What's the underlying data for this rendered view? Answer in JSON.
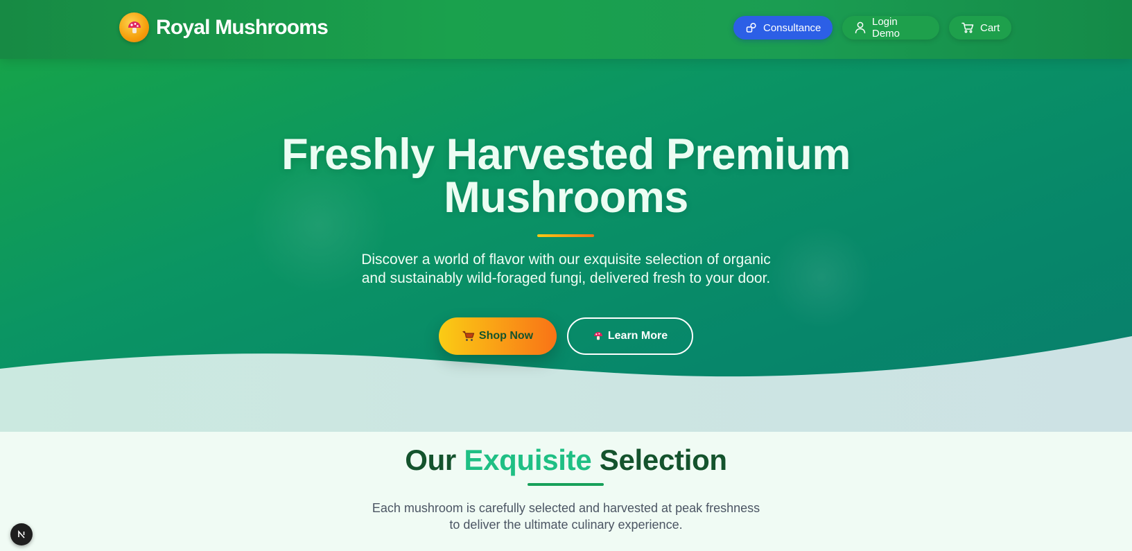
{
  "header": {
    "brand": "Royal Mushrooms",
    "nav": {
      "consult_label": "Consultance",
      "login_label": "Login Demo",
      "cart_label": "Cart"
    }
  },
  "hero": {
    "title_line1": "Freshly Harvested Premium",
    "title_line2": "Mushrooms",
    "subtitle_line1": "Discover a world of flavor with our exquisite selection of organic",
    "subtitle_line2": "and sustainably wild-foraged fungi, delivered fresh to your door.",
    "shop_label": "Shop Now",
    "learn_label": "Learn More"
  },
  "section": {
    "title_part1": "Our",
    "title_accent": "Exquisite",
    "title_part2": "Selection",
    "subtitle_line1": "Each mushroom is carefully selected and harvested at peak freshness",
    "subtitle_line2": "to deliver the ultimate culinary experience."
  },
  "colors": {
    "primary_green": "#1aa14d",
    "consult_blue": "#2c5fe6",
    "accent_yellow": "#facc15",
    "accent_orange": "#f97316",
    "title_dark_green": "#14532d",
    "title_accent": "#1fbf84"
  },
  "icons": {
    "logo": "mushroom-icon",
    "consult": "shapes-icon",
    "login": "user-icon",
    "cart": "cart-icon",
    "shop": "cart-icon",
    "learn": "mushroom-icon",
    "dev_badge": "nextjs-icon"
  }
}
